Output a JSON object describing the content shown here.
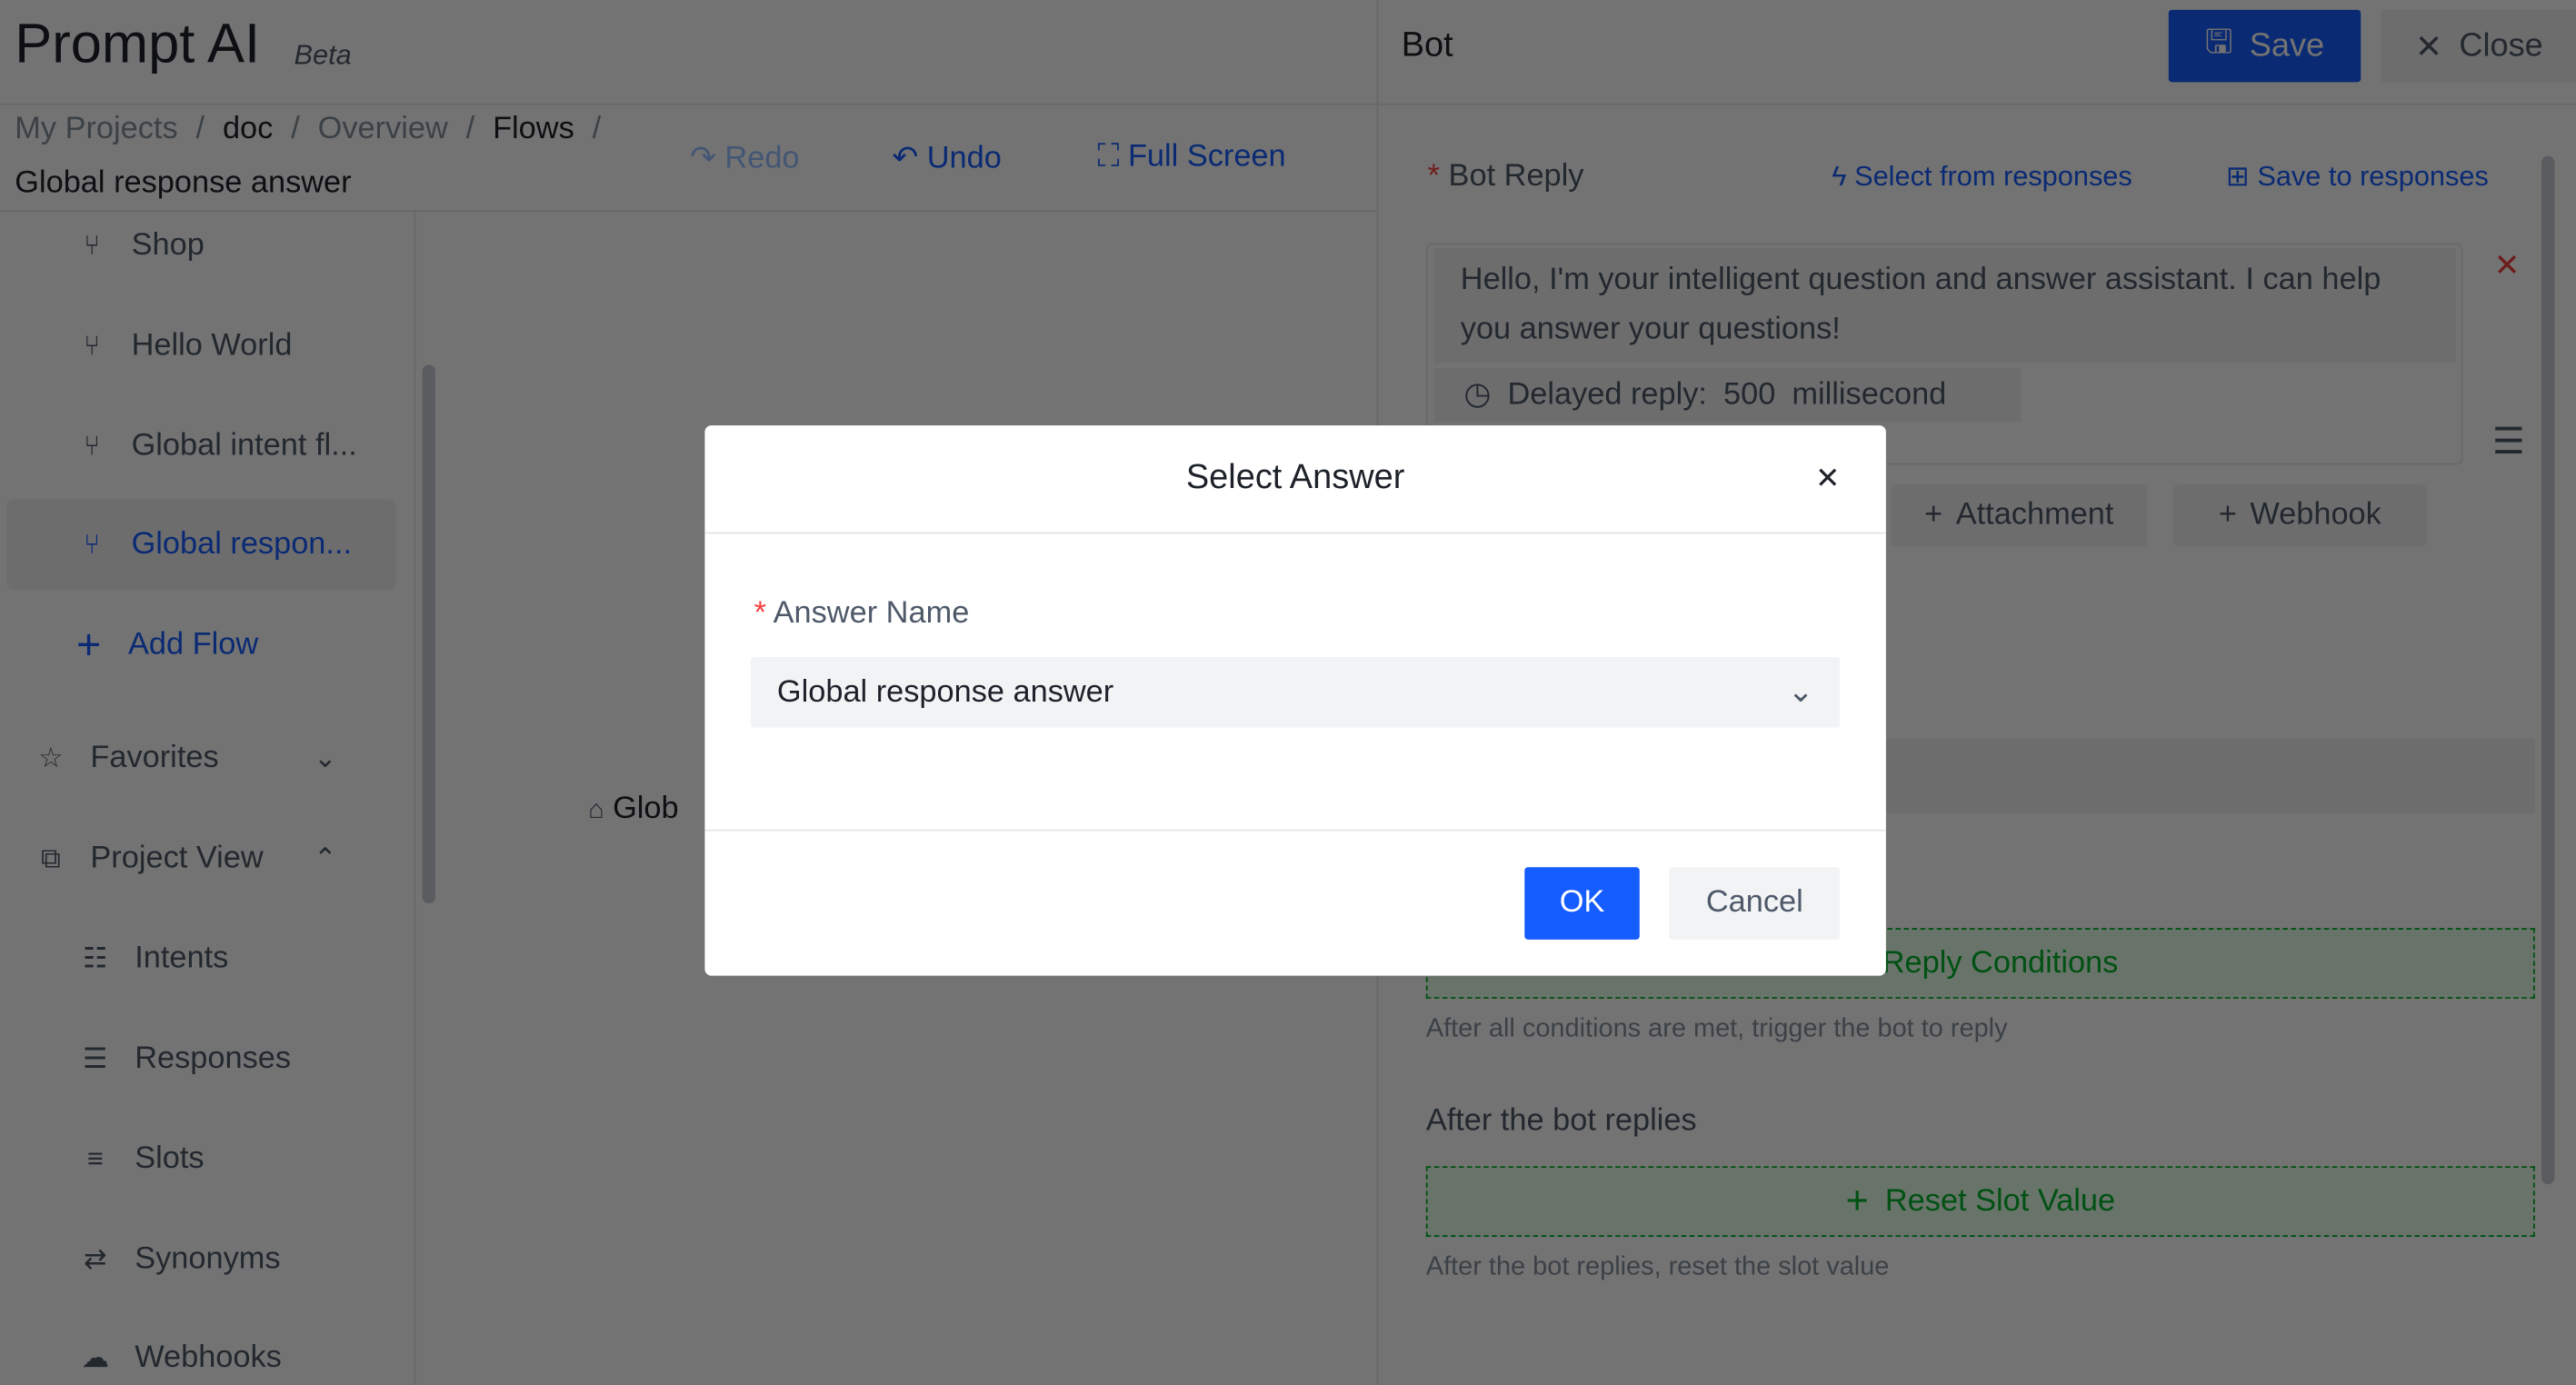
{
  "app": {
    "title": "Prompt AI",
    "badge": "Beta"
  },
  "breadcrumb": [
    "My Projects",
    "doc",
    "Overview",
    "Flows"
  ],
  "flow_title": "Global response answer",
  "toolbar": {
    "redo": "Redo",
    "undo": "Undo",
    "full_screen": "Full Screen"
  },
  "sidebar": {
    "flows": [
      "Shop",
      "Hello World",
      "Global intent fl...",
      "Global respon..."
    ],
    "add_flow": "Add Flow",
    "favorites": "Favorites",
    "project_view": "Project View",
    "project_items": [
      "Intents",
      "Responses",
      "Slots",
      "Synonyms",
      "Webhooks"
    ]
  },
  "canvas": {
    "node_label": "Glob"
  },
  "panel": {
    "title": "Bot",
    "save": "Save",
    "close": "Close",
    "bot_reply_label": "Bot Reply",
    "select_from_responses": "Select from responses",
    "save_to_responses": "Save to responses",
    "reply_text": "Hello, I'm your intelligent question and answer assistant. I can help you answer your questions!",
    "delay_label": "Delayed reply:",
    "delay_value": "500",
    "delay_unit": "millisecond",
    "attachment": "Attachment",
    "webhook": "Webhook",
    "reply_conditions": "Reply Conditions",
    "reply_conditions_hint": "After all conditions are met, trigger the bot to reply",
    "after_title": "After the bot replies",
    "reset_slot": "Reset Slot Value",
    "reset_slot_hint": "After the bot replies, reset the slot value"
  },
  "modal": {
    "title": "Select Answer",
    "field_label": "Answer Name",
    "selected_value": "Global response answer",
    "ok": "OK",
    "cancel": "Cancel"
  },
  "colors": {
    "primary": "#165dff",
    "danger": "#f53f3f",
    "success": "#00b42a"
  }
}
